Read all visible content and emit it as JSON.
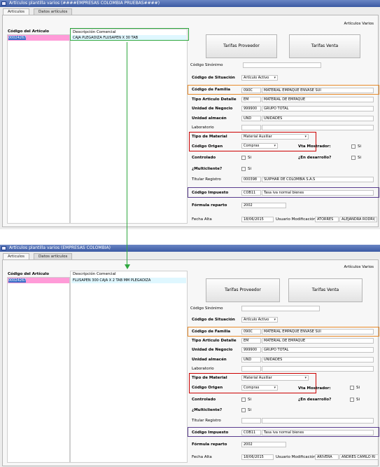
{
  "tabs": {
    "articles": "Articulos",
    "data": "Datos artículos"
  },
  "labels": {
    "codigo_articulo": "Código del Artículo",
    "descripcion_comercial": "Descripción Comercial",
    "articulos_varios": "Artículos Varios",
    "tarifas_proveedor": "Tarifas Proveedor",
    "tarifas_venta": "Tarifas Venta",
    "codigo_sinonimo": "Código Sinónimo",
    "codigo_situacion": "Código de Situación",
    "codigo_familia": "Código de Familia",
    "tipo_articulo_detalle": "Tipo Articulo Detalle",
    "unidad_negocio": "Unidad de Negocio",
    "unidad_almacen": "Unidad almacén",
    "laboratorio": "Laboratorio",
    "tipo_material": "Tipo de Material",
    "codigo_origen": "Código Origen",
    "vta_mostrador": "Vta Mostrador:",
    "controlado": "Controlado",
    "en_desarrollo": "¿En desarrollo?",
    "multicliente": "¿Multicliente?",
    "titular_registro": "Titular Registro",
    "codigo_impuesto": "Código Impuesto",
    "formula_reparto": "Fórmula reparto",
    "fecha_alta": "Fecha Alta",
    "usuario_modificacion": "Usuario Modificación",
    "si": "Si"
  },
  "windows": [
    {
      "title": "Artículos plantilla varios (####EMPRESAS COLOMBIA PRUEBAS####)",
      "codigo": "00024267",
      "descripcion": "CAJA PLEGADIZA FLUSAPEN X 30 TAB",
      "situacion": "Artículo Activo",
      "familia_code": "090C",
      "familia_desc": "MATERIAL EMPAQUE ENVASE SUI",
      "tipo_detalle_code": "EM",
      "tipo_detalle_desc": "MATERIAL DE EMPAQUE",
      "negocio_code": "999900",
      "negocio_desc": "GRUPO TOTAL",
      "almacen_code": "UND",
      "almacen_desc": "UNIDADES",
      "tipo_material": "Material Auxiliar",
      "origen": "Compras",
      "titular_code": "000398",
      "titular_desc": "SUIPHAR DE COLOMBIA S.A.S",
      "impuesto_code": "COB11",
      "impuesto_desc": "Tasa iva normal bienes",
      "formula": "2002",
      "fecha_alta": "18/06/2015",
      "usuario_code": "ATORRES",
      "usuario_name": "ALEJANDRA RODRI("
    },
    {
      "title": "Artículos plantilla varios (EMPRESAS COLOMBIA)",
      "codigo": "00024267",
      "descripcion": "FLUSAPEN 300 CAJA X 2 TAB MM PLEGADIZA",
      "situacion": "Artículo Activo",
      "familia_code": "090C",
      "familia_desc": "MATERIAL EMPAQUE ENVASE SUI",
      "tipo_detalle_code": "EM",
      "tipo_detalle_desc": "MATERIAL DE EMPAQUE",
      "negocio_code": "999900",
      "negocio_desc": "GRUPO TOTAL",
      "almacen_code": "UND",
      "almacen_desc": "UNIDADES",
      "tipo_material": "Material Auxiliar",
      "origen": "Compras",
      "titular_code": "",
      "titular_desc": "",
      "impuesto_code": "COB11",
      "impuesto_desc": "Tasa iva normal bienes",
      "formula": "2002",
      "fecha_alta": "18/06/2015",
      "usuario_code": "ARIVERA",
      "usuario_name": "ANDRES CAMILO RI"
    }
  ],
  "colors": {
    "familia_highlight": "#e88a2a",
    "material_highlight": "#cc0000",
    "impuesto_highlight": "#5a3d8f",
    "arrow": "#2fa83f",
    "selected_code_bg": "#ff9bd8",
    "selected_desc_bg": "#dff7ff"
  }
}
